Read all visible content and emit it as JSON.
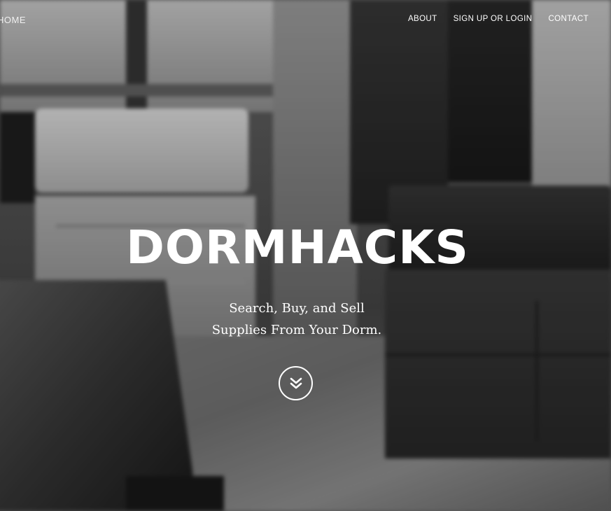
{
  "nav": {
    "home_label": "HOME",
    "links": [
      {
        "label": "ABOUT"
      },
      {
        "label": "SIGN UP OR LOGIN"
      },
      {
        "label": "CONTACT"
      }
    ]
  },
  "hero": {
    "title": "DORMHACKS",
    "tagline_line1": "Search, Buy, and Sell",
    "tagline_line2": "Supplies From Your Dorm.",
    "scroll_icon": "double-chevron-down-icon"
  },
  "colors": {
    "text": "#ffffff"
  }
}
